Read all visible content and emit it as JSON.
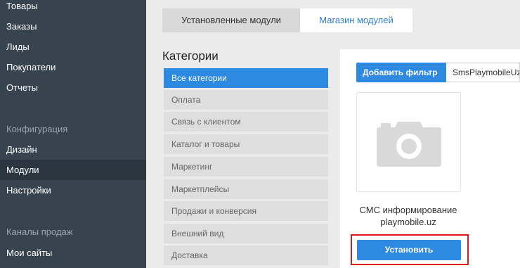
{
  "sidebar": {
    "items_top": [
      "Товары",
      "Заказы",
      "Лиды",
      "Покупатели",
      "Отчеты"
    ],
    "section_config": "Конфигурация",
    "items_config": [
      "Дизайн",
      "Модули",
      "Настройки"
    ],
    "section_channels": "Каналы продаж",
    "items_channels": [
      "Мои сайты"
    ]
  },
  "tabs": {
    "installed": "Установленные модули",
    "store": "Магазин модулей"
  },
  "categories": {
    "title": "Категории",
    "items": [
      "Все категории",
      "Оплата",
      "Связь с клиентом",
      "Каталог и товары",
      "Маркетинг",
      "Маркетплейсы",
      "Продажи и конверсия",
      "Внешний вид",
      "Доставка"
    ]
  },
  "filter": {
    "button_label": "Добавить фильтр",
    "value": "SmsPlaymobileUz"
  },
  "module": {
    "name_line1": "СМС информирование",
    "name_line2": "playmobile.uz",
    "install_label": "Установить"
  },
  "colors": {
    "accent": "#2d8ae0",
    "sidebar": "#37434f",
    "highlight": "#e0161e"
  }
}
